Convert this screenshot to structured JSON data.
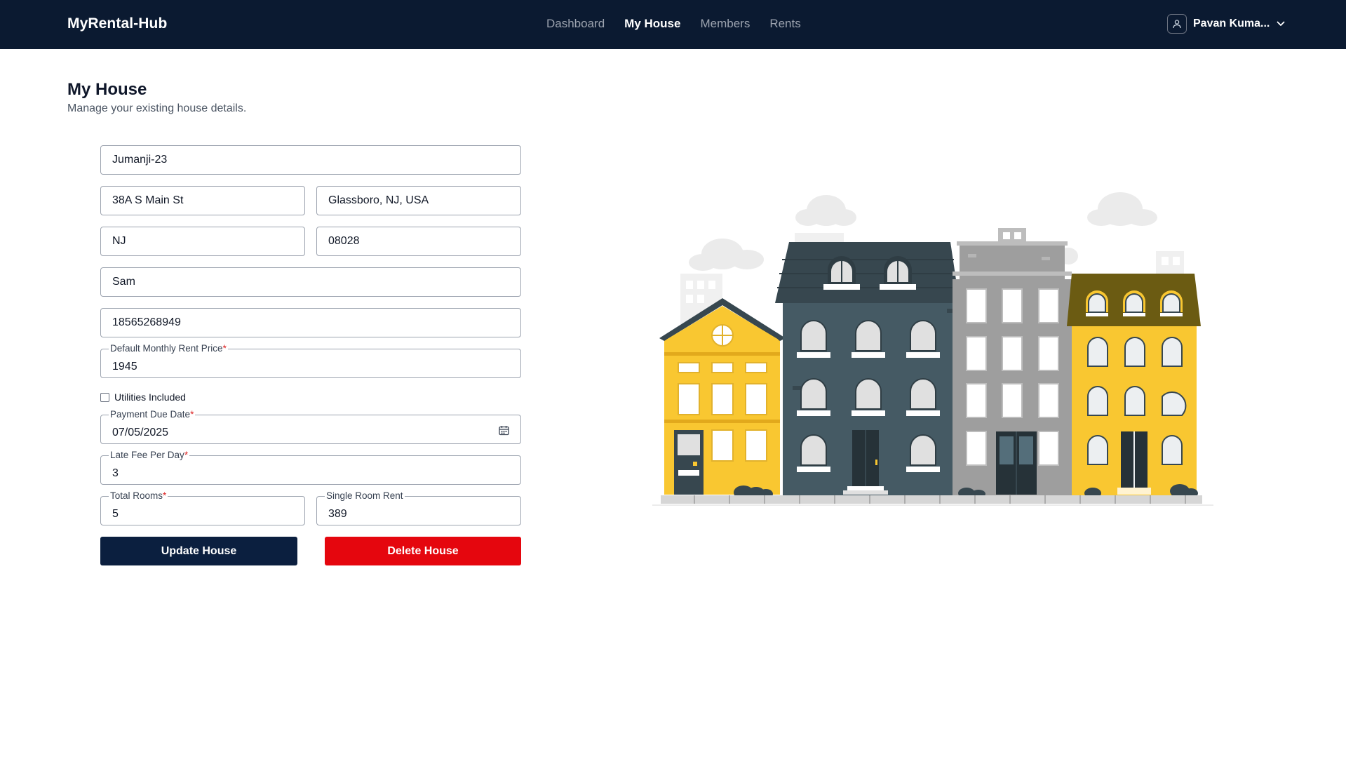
{
  "navbar": {
    "brand": "MyRental-Hub",
    "links": [
      {
        "label": "Dashboard",
        "active": false
      },
      {
        "label": "My House",
        "active": true
      },
      {
        "label": "Members",
        "active": false
      },
      {
        "label": "Rents",
        "active": false
      }
    ],
    "user": {
      "name": "Pavan Kuma...",
      "icon": "user-icon"
    }
  },
  "page": {
    "title": "My House",
    "subtitle": "Manage your existing house details."
  },
  "form": {
    "house_name": "Jumanji-23",
    "street": "38A S Main St",
    "city": "Glassboro, NJ, USA",
    "state": "NJ",
    "zip": "08028",
    "owner": "Sam",
    "phone": "18565268949",
    "rent_price": {
      "label": "Default Monthly Rent Price",
      "required": "*",
      "value": "1945"
    },
    "utilities": {
      "label": "Utilities Included",
      "checked": false
    },
    "due_date": {
      "label": "Payment Due Date",
      "required": "*",
      "value": "07/05/2025",
      "icon": "calendar-icon"
    },
    "late_fee": {
      "label": "Late Fee Per Day",
      "required": "*",
      "value": "3"
    },
    "total_rooms": {
      "label": "Total Rooms",
      "required": "*",
      "value": "5"
    },
    "single_room_rent": {
      "label": "Single Room Rent",
      "value": "389"
    },
    "update_button": "Update House",
    "delete_button": "Delete House"
  },
  "colors": {
    "navbar_bg": "#0b1a31",
    "update_button": "#0b1f3f",
    "delete_button": "#e5060e",
    "required_asterisk": "#dc2626"
  }
}
